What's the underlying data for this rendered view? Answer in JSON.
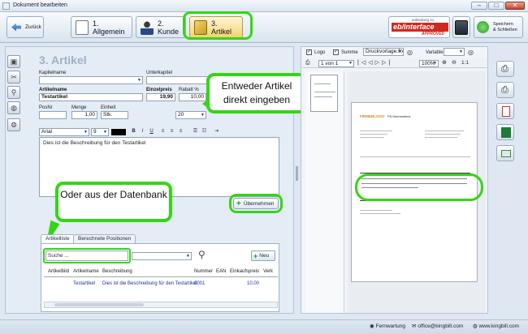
{
  "window": {
    "title": "Dokument bearbeiten"
  },
  "toolbar": {
    "back_label": "Zurück",
    "tabs": [
      {
        "label": "1. Allgemein"
      },
      {
        "label": "2. Kunde"
      },
      {
        "label": "3. Artikel"
      }
    ],
    "ebi_small": "anbindung zu",
    "ebi_logo": "eb/interface",
    "ebi_badge": "APPROVED",
    "save_close_label": "Speichern\n& Schließen"
  },
  "article": {
    "heading": "3. Artikel",
    "kapitelname_label": "Kapitelname",
    "unterkapitel_label": "Unterkapitel",
    "artikelname_label": "Artikelname",
    "einzelpreis_label": "Einzelpreis",
    "rabatt_label": "Rabatt %",
    "artikelname_value": "Testartikel",
    "einzelpreis_value": "19,90",
    "rabatt_value": "10,00",
    "posnr_label": "PosNr",
    "menge_label": "Menge",
    "einheit_label": "Einheit",
    "menge_value": "1,00",
    "einheit_value": "Stk.",
    "mwst_value": "20",
    "font_value": "Arial",
    "size_value": "9",
    "description": "Dies ist die Beschreibung für den Testartikel",
    "uebernehmen_label": "Übernehmen"
  },
  "callouts": {
    "top": "Entweder Artikel direkt eingeben",
    "bottom": "Oder aus der Datenbank"
  },
  "lower": {
    "tabs": [
      {
        "label": "Artikelliste"
      },
      {
        "label": "Berechnete Positionen"
      }
    ],
    "search_placeholder": "Suche ...",
    "new_label": "Neu",
    "columns": [
      "Artikelbild",
      "Artikelname",
      "Beschreibung",
      "Nummer",
      "EAN",
      "Einkaufspreis",
      "Verk"
    ],
    "rows": [
      [
        "",
        "Testartikel",
        "Dies ist die Beschreibung für den Testartikel",
        "0001",
        "",
        "10,00",
        ""
      ]
    ]
  },
  "preview": {
    "logo_label": "Logo",
    "summe_label": "Summe",
    "template_value": "Druckvorlage.frx",
    "variable_label": "Variable",
    "page_value": "1 von 1",
    "zoom_value": "100%",
    "ratio_label": "1:1",
    "doc_logo": "FIRMENLOGO",
    "doc_company": "FB Werbealiens",
    "colors": {
      "highlight": "#33d614",
      "ebi_red": "#d3271f"
    }
  },
  "status": {
    "fernwartung": "Fernwartung",
    "email": "office@kingbill.com",
    "web": "www.kingbill.com"
  }
}
